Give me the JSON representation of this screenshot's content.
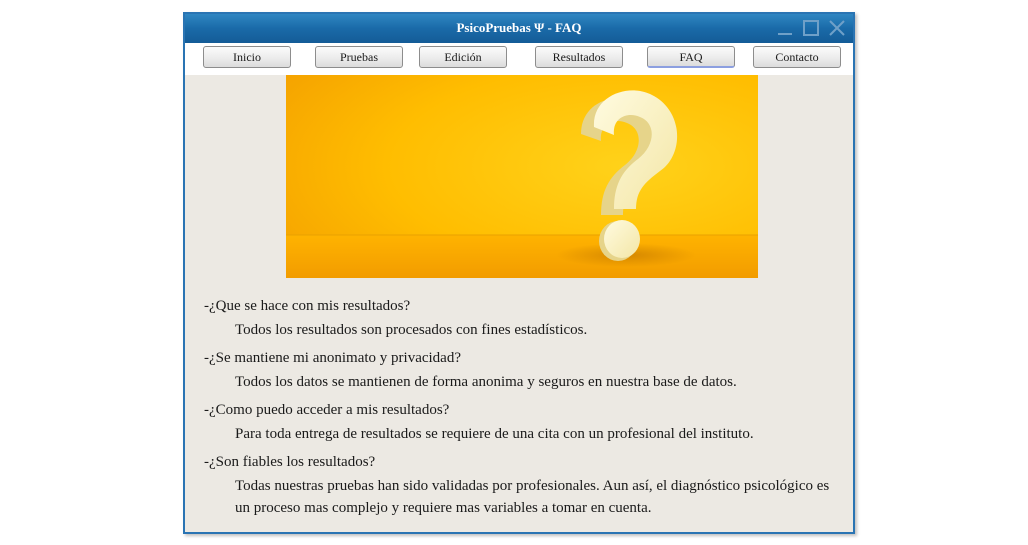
{
  "window": {
    "title": "PsicoPruebas Ψ - FAQ"
  },
  "nav": {
    "items": [
      {
        "label": "Inicio"
      },
      {
        "label": "Pruebas"
      },
      {
        "label": "Edición"
      },
      {
        "label": "Resultados"
      },
      {
        "label": "FAQ"
      },
      {
        "label": "Contacto"
      }
    ],
    "active": "FAQ"
  },
  "hero": {
    "icon": "question-mark-3d",
    "background_color": "#ffb400",
    "symbol_color": "#fdf3c2"
  },
  "faq": [
    {
      "question": "-¿Que se hace con mis resultados?",
      "answer": "Todos los resultados son procesados con fines estadísticos."
    },
    {
      "question": "-¿Se mantiene mi anonimato y privacidad?",
      "answer": "Todos los datos se mantienen de forma anonima y seguros en nuestra base de datos."
    },
    {
      "question": "-¿Como puedo acceder a mis resultados?",
      "answer": "Para toda entrega de resultados se requiere de una cita con un profesional del instituto."
    },
    {
      "question": "-¿Son fiables los resultados?",
      "answer": "Todas nuestras pruebas han sido validadas por profesionales. Aun así, el diagnóstico psicológico es un proceso mas complejo y requiere mas variables a tomar en cuenta."
    }
  ],
  "colors": {
    "titlebar": "#1a6aa8",
    "window_border": "#2a74b3",
    "content_bg": "#ece9e3",
    "active_tab_underline": "#8c9fe0"
  }
}
